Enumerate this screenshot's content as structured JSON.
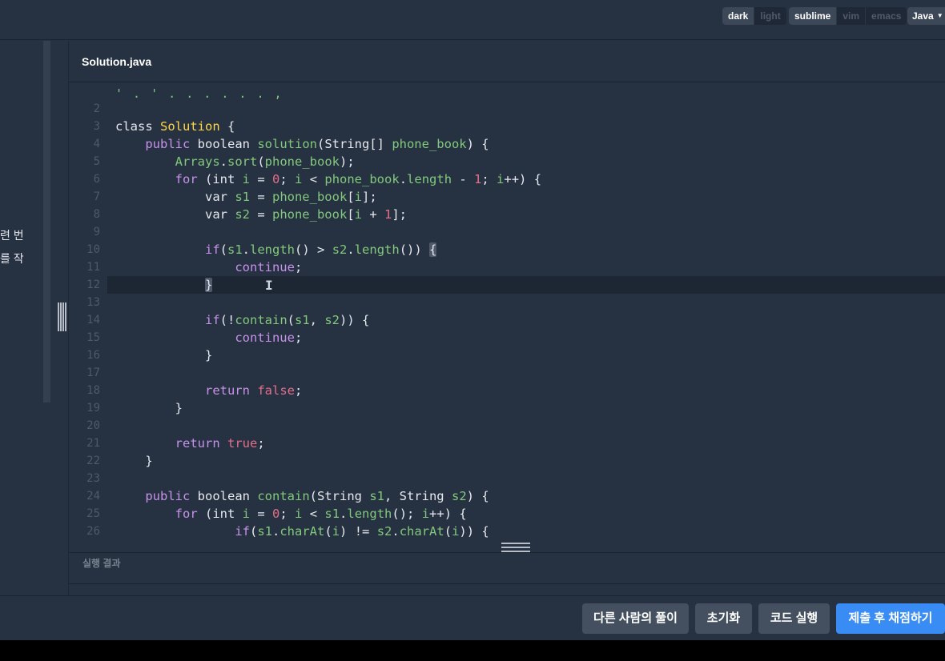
{
  "toolbar": {
    "theme_options": [
      "dark",
      "light"
    ],
    "theme_selected": "dark",
    "keymap_options": [
      "sublime",
      "vim",
      "emacs"
    ],
    "keymap_selected": "sublime",
    "language": "Java"
  },
  "problem_pane": {
    "text_fragments": [
      "련 번",
      "를 작"
    ]
  },
  "editor": {
    "file_name": "Solution.java",
    "active_line": 12,
    "lines": [
      {
        "n": "2",
        "code": ""
      },
      {
        "n": "3",
        "code": "class Solution {"
      },
      {
        "n": "4",
        "code": "    public boolean solution(String[] phone_book) {"
      },
      {
        "n": "5",
        "code": "        Arrays.sort(phone_book);"
      },
      {
        "n": "6",
        "code": "        for (int i = 0; i < phone_book.length - 1; i++) {"
      },
      {
        "n": "7",
        "code": "            var s1 = phone_book[i];"
      },
      {
        "n": "8",
        "code": "            var s2 = phone_book[i + 1];"
      },
      {
        "n": "9",
        "code": ""
      },
      {
        "n": "10",
        "code": "            if(s1.length() > s2.length()) {"
      },
      {
        "n": "11",
        "code": "                continue;"
      },
      {
        "n": "12",
        "code": "            }"
      },
      {
        "n": "13",
        "code": ""
      },
      {
        "n": "14",
        "code": "            if(!contain(s1, s2)) {"
      },
      {
        "n": "15",
        "code": "                continue;"
      },
      {
        "n": "16",
        "code": "            }"
      },
      {
        "n": "17",
        "code": ""
      },
      {
        "n": "18",
        "code": "            return false;"
      },
      {
        "n": "19",
        "code": "        }"
      },
      {
        "n": "20",
        "code": ""
      },
      {
        "n": "21",
        "code": "        return true;"
      },
      {
        "n": "22",
        "code": "    }"
      },
      {
        "n": "23",
        "code": ""
      },
      {
        "n": "24",
        "code": "    public boolean contain(String s1, String s2) {"
      },
      {
        "n": "25",
        "code": "        for (int i = 0; i < s1.length(); i++) {"
      },
      {
        "n": "26",
        "code": "                if(s1.charAt(i) != s2.charAt(i)) {"
      }
    ]
  },
  "result": {
    "label": "실행 결과"
  },
  "actions": {
    "others_solutions": "다른 사람의 풀이",
    "reset": "초기화",
    "run_code": "코드 실행",
    "submit": "제출 후 채점하기"
  },
  "colors": {
    "background": "#263141",
    "submit_button": "#3a8cf5",
    "secondary_button": "#44505f",
    "keyword": "#c792ea",
    "function": "#82c97c",
    "class_name": "#ffd84a",
    "number": "#e36f8a"
  }
}
